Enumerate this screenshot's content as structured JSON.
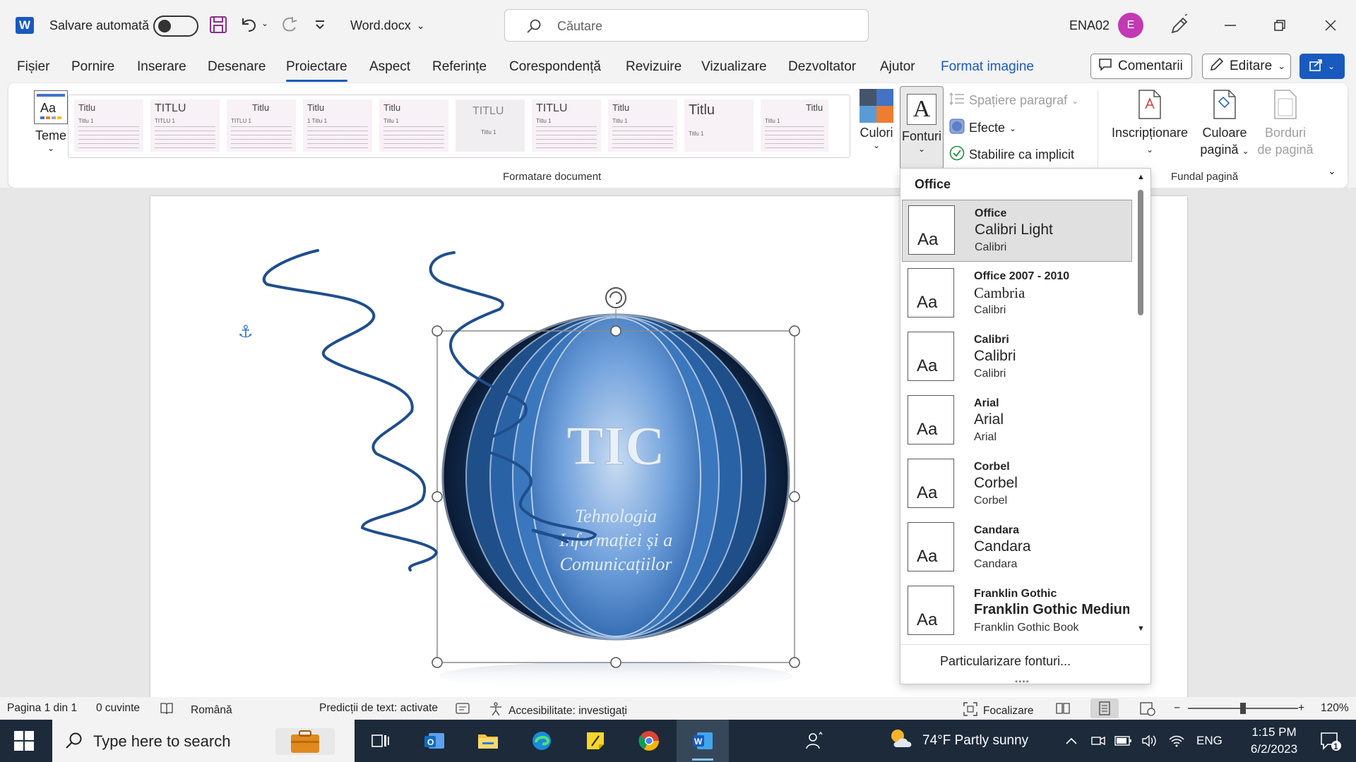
{
  "titlebar": {
    "app_icon_letter": "W",
    "autosave_label": "Salvare automată",
    "doc_title": "Word.docx",
    "search_placeholder": "Căutare",
    "user_name": "ENA02",
    "avatar_letter": "E"
  },
  "menu": {
    "tabs": [
      "Fișier",
      "Pornire",
      "Inserare",
      "Desenare",
      "Proiectare",
      "Aspect",
      "Referințe",
      "Corespondență",
      "Revizuire",
      "Vizualizare",
      "Dezvoltator",
      "Ajutor",
      "Format imagine"
    ],
    "active_tab": "Proiectare",
    "comments_label": "Comentarii",
    "editing_label": "Editare"
  },
  "ribbon": {
    "themes_label": "Teme",
    "style_gallery": [
      {
        "title": "Titlu",
        "sub": "Titlu 1"
      },
      {
        "title": "TITLU",
        "sub": "TITLU 1"
      },
      {
        "title": "Titlu",
        "sub": "TITLU 1"
      },
      {
        "title": "Titlu",
        "sub": "1  Titlu 1"
      },
      {
        "title": "Titlu",
        "sub": "Titlu 1"
      },
      {
        "title": "TITLU",
        "sub": "Titlu 1"
      },
      {
        "title": "TITLU",
        "sub": "Titlu 1"
      },
      {
        "title": "Titlu",
        "sub": "Titlu 1"
      },
      {
        "title": "Titlu",
        "sub": "Titlu 1"
      },
      {
        "title": "Titlu",
        "sub": "Titlu 1"
      }
    ],
    "group_format_label": "Formatare document",
    "colors_label": "Culori",
    "fonts_label": "Fonturi",
    "paragraph_spacing_label": "Spațiere paragraf",
    "effects_label": "Efecte",
    "set_default_label": "Stabilire ca implicit",
    "watermark_label": "Inscripționare",
    "page_color_label_1": "Culoare",
    "page_color_label_2": "pagină",
    "page_borders_label_1": "Borduri",
    "page_borders_label_2": "de pagină",
    "group_background_label": "Fundal pagină"
  },
  "fonts_dropdown": {
    "header": "Office",
    "items": [
      {
        "name": "Office",
        "heading": "Calibri Light",
        "body": "Calibri"
      },
      {
        "name": "Office 2007 - 2010",
        "heading": "Cambria",
        "body": "Calibri"
      },
      {
        "name": "Calibri",
        "heading": "Calibri",
        "body": "Calibri"
      },
      {
        "name": "Arial",
        "heading": "Arial",
        "body": "Arial"
      },
      {
        "name": "Corbel",
        "heading": "Corbel",
        "body": "Corbel"
      },
      {
        "name": "Candara",
        "heading": "Candara",
        "body": "Candara"
      },
      {
        "name": "Franklin Gothic",
        "heading": "Franklin Gothic Medium",
        "body": "Franklin Gothic Book"
      }
    ],
    "thumb_text": "Aa",
    "customize_label": "Particularizare fonturi..."
  },
  "document": {
    "logo_title": "TIC",
    "logo_line1": "Tehnologia",
    "logo_line2": "Informației și a",
    "logo_line3": "Comunicațiilor"
  },
  "statusbar": {
    "page": "Pagina 1 din 1",
    "words": "0 cuvinte",
    "language": "Română",
    "predictions": "Predicții de text: activate",
    "accessibility": "Accesibilitate: investigați",
    "focus": "Focalizare",
    "zoom": "120%"
  },
  "taskbar": {
    "search_placeholder": "Type here to search",
    "weather": "74°F  Partly sunny",
    "lang": "ENG",
    "time": "1:15 PM",
    "date": "6/2/2023",
    "notif_count": "1"
  },
  "colors": {
    "accent": "#185abd",
    "avatar": "#c239b3",
    "scribble": "#1f4e8c",
    "logo_blue": "#5b8fd0"
  }
}
